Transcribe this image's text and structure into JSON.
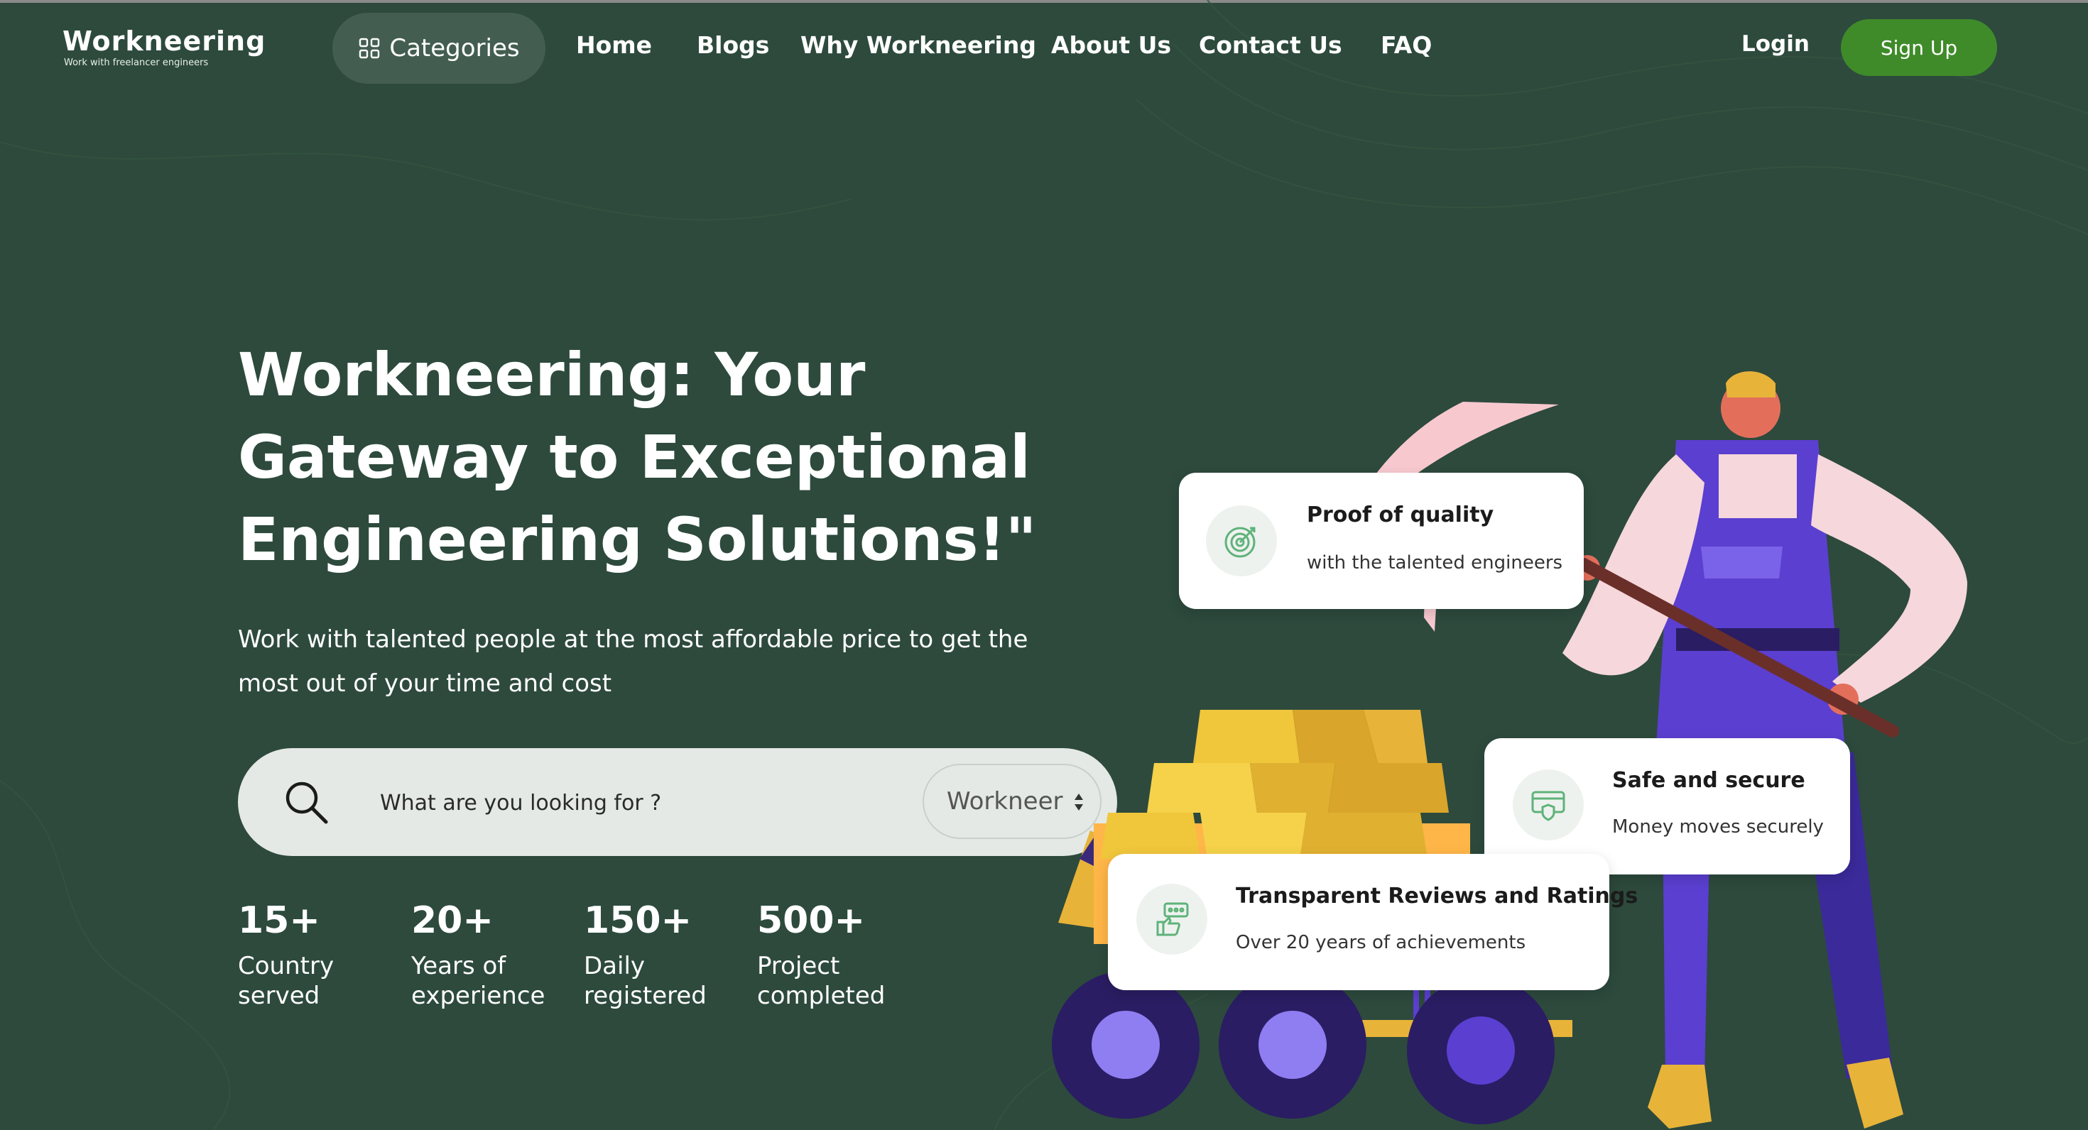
{
  "brand": {
    "name": "Workneering",
    "tagline": "Work with freelancer engineers"
  },
  "nav": {
    "categories_label": "Categories",
    "items": [
      "Home",
      "Blogs",
      "Why Workneering",
      "About Us",
      "Contact Us",
      "FAQ"
    ],
    "login_label": "Login",
    "signup_label": "Sign Up"
  },
  "hero": {
    "title_lines": [
      "Workneering: Your",
      "Gateway to Exceptional",
      "Engineering Solutions!\""
    ],
    "subtitle_lines": [
      "Work with talented people at the most affordable price to get the",
      "most out of your time and cost"
    ]
  },
  "search": {
    "placeholder": "What are you looking for ?",
    "value": "",
    "select_value": "Workneer",
    "select_options": [
      "Workneer"
    ]
  },
  "stats": [
    {
      "value": "15+",
      "label_lines": [
        "Country",
        "served"
      ]
    },
    {
      "value": "20+",
      "label_lines": [
        "Years of",
        "experience"
      ]
    },
    {
      "value": "150+",
      "label_lines": [
        "Daily",
        "registered"
      ]
    },
    {
      "value": "500+",
      "label_lines": [
        "Project",
        "completed"
      ]
    }
  ],
  "cards": [
    {
      "title": "Proof of quality",
      "text": "with the talented engineers",
      "icon": "target-icon"
    },
    {
      "title": "Safe and secure",
      "text": "Money moves securely",
      "icon": "secure-payment-icon"
    },
    {
      "title": "Transparent Reviews and Ratings",
      "text": "Over 20 years of achievements",
      "icon": "rating-thumbs-up-icon"
    }
  ],
  "colors": {
    "background": "#2d4a3d",
    "categories_pill": "#435e51",
    "signup": "#3f8b2a",
    "search_bar": "#e4e9e5",
    "card": "#ffffff",
    "worker_overalls": "#5b3fd0",
    "gold": "#e8c24a"
  }
}
